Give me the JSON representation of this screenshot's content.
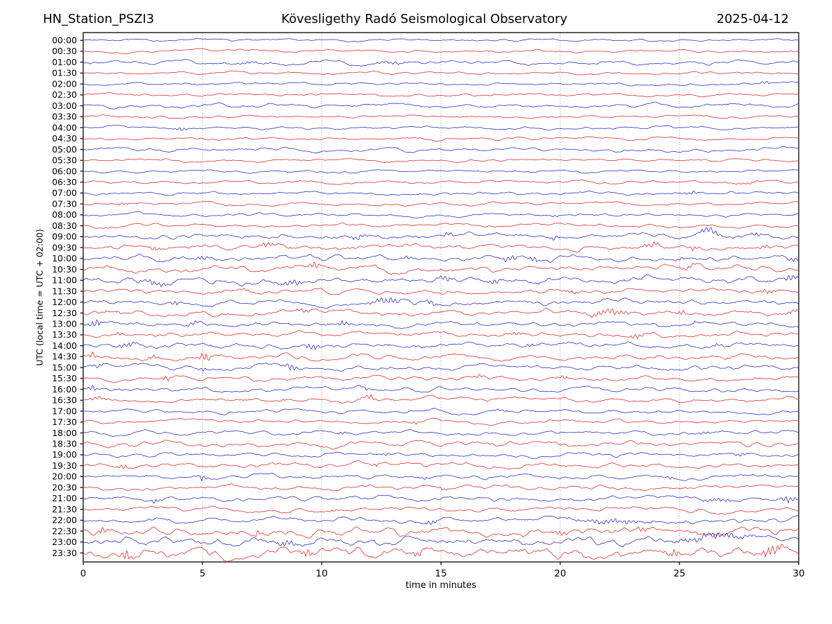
{
  "header": {
    "station": "HN_Station_PSZI3",
    "observatory": "Kövesligethy Radó Seismological Observatory",
    "date": "2025-04-12"
  },
  "chart_data": {
    "type": "line",
    "variant": "helicorder-seismogram",
    "title": "HN_Station_PSZI3 — Kövesligethy Radó Seismological Observatory — 2025-04-12",
    "xlabel": "time in minutes",
    "ylabel": "UTC (local time = UTC + 02:00)",
    "x_range": [
      0,
      30
    ],
    "xticks": [
      0,
      5,
      10,
      15,
      20,
      25,
      30
    ],
    "grid_minutes": [
      5,
      10,
      15,
      20,
      25
    ],
    "grid_on": true,
    "legend": "none",
    "row_interval_minutes": 30,
    "colors": {
      "blue_trace": "#2323cc",
      "red_trace": "#e02020",
      "grid": "#777777",
      "axis": "#000000",
      "text": "#000000"
    },
    "traces": [
      {
        "label": "00:00",
        "color": "blue",
        "amp": 0.45,
        "events": []
      },
      {
        "label": "00:30",
        "color": "red",
        "amp": 0.45,
        "events": []
      },
      {
        "label": "01:00",
        "color": "blue",
        "amp": 0.75,
        "events": [
          [
            7.0,
            2.0,
            0.6
          ],
          [
            13.0,
            2.0,
            0.6
          ]
        ]
      },
      {
        "label": "01:30",
        "color": "red",
        "amp": 0.5,
        "events": []
      },
      {
        "label": "02:00",
        "color": "blue",
        "amp": 0.5,
        "events": [
          [
            28.6,
            0.4,
            1.0
          ]
        ]
      },
      {
        "label": "02:30",
        "color": "red",
        "amp": 0.55,
        "events": []
      },
      {
        "label": "03:00",
        "color": "blue",
        "amp": 0.7,
        "events": []
      },
      {
        "label": "03:30",
        "color": "red",
        "amp": 0.5,
        "events": []
      },
      {
        "label": "04:00",
        "color": "blue",
        "amp": 0.5,
        "events": [
          [
            4.1,
            0.6,
            1.2
          ]
        ]
      },
      {
        "label": "04:30",
        "color": "red",
        "amp": 0.5,
        "events": []
      },
      {
        "label": "05:00",
        "color": "blue",
        "amp": 0.7,
        "events": []
      },
      {
        "label": "05:30",
        "color": "red",
        "amp": 0.5,
        "events": [
          [
            12.8,
            0.4,
            0.8
          ]
        ]
      },
      {
        "label": "06:00",
        "color": "blue",
        "amp": 0.5,
        "events": []
      },
      {
        "label": "06:30",
        "color": "red",
        "amp": 0.55,
        "events": [
          [
            27.8,
            1.2,
            0.9
          ]
        ]
      },
      {
        "label": "07:00",
        "color": "blue",
        "amp": 0.6,
        "events": [
          [
            25.5,
            0.8,
            0.9
          ]
        ]
      },
      {
        "label": "07:30",
        "color": "red",
        "amp": 0.55,
        "events": [
          [
            1.6,
            0.4,
            0.9
          ]
        ]
      },
      {
        "label": "08:00",
        "color": "blue",
        "amp": 0.55,
        "events": [
          [
            19.8,
            0.3,
            1.3
          ]
        ]
      },
      {
        "label": "08:30",
        "color": "red",
        "amp": 0.6,
        "events": []
      },
      {
        "label": "09:00",
        "color": "blue",
        "amp": 1.1,
        "events": [
          [
            11.5,
            0.5,
            1.8
          ],
          [
            15.3,
            0.5,
            1.8
          ],
          [
            19.8,
            0.4,
            1.8
          ],
          [
            26.3,
            0.8,
            2.2
          ],
          [
            28.2,
            0.4,
            1.6
          ]
        ]
      },
      {
        "label": "09:30",
        "color": "red",
        "amp": 1.0,
        "events": [
          [
            3.0,
            0.5,
            1.4
          ],
          [
            7.7,
            0.5,
            1.9
          ],
          [
            23.8,
            0.6,
            1.9
          ],
          [
            25.6,
            0.4,
            1.4
          ],
          [
            28.5,
            0.5,
            1.4
          ]
        ]
      },
      {
        "label": "10:00",
        "color": "blue",
        "amp": 1.0,
        "events": [
          [
            5.0,
            0.5,
            1.5
          ],
          [
            13.6,
            0.4,
            1.4
          ],
          [
            17.9,
            0.5,
            2.2
          ],
          [
            18.9,
            0.4,
            1.8
          ],
          [
            25.1,
            0.4,
            1.4
          ],
          [
            29.8,
            0.4,
            1.8
          ]
        ]
      },
      {
        "label": "10:30",
        "color": "red",
        "amp": 1.1,
        "events": [
          [
            9.7,
            0.5,
            2.2
          ],
          [
            25.4,
            0.5,
            1.4
          ]
        ]
      },
      {
        "label": "11:00",
        "color": "blue",
        "amp": 1.2,
        "events": [
          [
            3.0,
            1.5,
            1.7
          ],
          [
            8.8,
            1.0,
            2.2
          ],
          [
            15.2,
            0.5,
            2.6
          ],
          [
            17.2,
            0.5,
            1.5
          ],
          [
            29.7,
            0.5,
            2.6
          ]
        ]
      },
      {
        "label": "11:30",
        "color": "red",
        "amp": 0.9,
        "events": [
          [
            6.8,
            0.4,
            1.4
          ],
          [
            20.6,
            0.5,
            1.4
          ],
          [
            28.7,
            0.5,
            1.8
          ]
        ]
      },
      {
        "label": "12:00",
        "color": "blue",
        "amp": 1.0,
        "events": [
          [
            3.8,
            0.4,
            1.3
          ],
          [
            12.7,
            1.2,
            2.2
          ],
          [
            14.6,
            0.5,
            1.8
          ]
        ]
      },
      {
        "label": "12:30",
        "color": "red",
        "amp": 1.0,
        "events": [
          [
            9.2,
            0.5,
            1.4
          ],
          [
            22.0,
            1.5,
            1.8
          ],
          [
            25.1,
            0.4,
            1.4
          ],
          [
            29.7,
            0.4,
            1.4
          ]
        ]
      },
      {
        "label": "13:00",
        "color": "blue",
        "amp": 1.0,
        "events": [
          [
            0.5,
            0.5,
            2.2
          ],
          [
            4.6,
            0.5,
            1.3
          ],
          [
            10.9,
            0.5,
            1.8
          ]
        ]
      },
      {
        "label": "13:30",
        "color": "red",
        "amp": 0.9,
        "events": [
          [
            1.5,
            0.4,
            1.0
          ],
          [
            18.2,
            0.5,
            1.0
          ],
          [
            23.2,
            0.5,
            2.2
          ]
        ]
      },
      {
        "label": "14:00",
        "color": "blue",
        "amp": 1.0,
        "events": [
          [
            1.8,
            0.8,
            1.8
          ],
          [
            9.6,
            0.5,
            2.2
          ],
          [
            18.8,
            0.5,
            1.4
          ],
          [
            26.6,
            0.5,
            1.3
          ]
        ]
      },
      {
        "label": "14:30",
        "color": "red",
        "amp": 1.0,
        "events": [
          [
            0.4,
            0.4,
            1.8
          ],
          [
            2.9,
            0.5,
            1.4
          ],
          [
            5.1,
            0.45,
            3.0
          ],
          [
            27.0,
            0.5,
            1.0
          ]
        ]
      },
      {
        "label": "15:00",
        "color": "blue",
        "amp": 0.9,
        "events": [
          [
            0.6,
            0.4,
            1.4
          ],
          [
            5.0,
            0.4,
            1.3
          ],
          [
            8.7,
            0.5,
            2.6
          ]
        ]
      },
      {
        "label": "15:30",
        "color": "red",
        "amp": 0.85,
        "events": [
          [
            3.5,
            0.3,
            2.4
          ],
          [
            16.6,
            0.4,
            1.0
          ],
          [
            20.1,
            0.5,
            1.3
          ],
          [
            28.2,
            0.4,
            1.0
          ]
        ]
      },
      {
        "label": "16:00",
        "color": "blue",
        "amp": 0.8,
        "events": [
          [
            0.4,
            0.4,
            2.0
          ],
          [
            11.9,
            0.4,
            1.0
          ]
        ]
      },
      {
        "label": "16:30",
        "color": "red",
        "amp": 0.8,
        "events": [
          [
            0.6,
            0.8,
            1.0
          ],
          [
            12.0,
            0.5,
            2.4
          ]
        ]
      },
      {
        "label": "17:00",
        "color": "blue",
        "amp": 0.7,
        "events": [
          [
            17.5,
            0.5,
            1.0
          ]
        ]
      },
      {
        "label": "17:30",
        "color": "red",
        "amp": 0.65,
        "events": [
          [
            13.9,
            0.4,
            0.9
          ]
        ]
      },
      {
        "label": "18:00",
        "color": "blue",
        "amp": 0.75,
        "events": [
          [
            10.9,
            0.4,
            1.0
          ],
          [
            26.0,
            0.5,
            0.9
          ]
        ]
      },
      {
        "label": "18:30",
        "color": "red",
        "amp": 0.95,
        "events": []
      },
      {
        "label": "19:00",
        "color": "blue",
        "amp": 0.8,
        "events": [
          [
            12.6,
            0.4,
            1.0
          ],
          [
            27.6,
            0.5,
            1.2
          ]
        ]
      },
      {
        "label": "19:30",
        "color": "red",
        "amp": 0.85,
        "events": [
          [
            1.7,
            0.4,
            1.9
          ],
          [
            12.3,
            0.4,
            1.0
          ]
        ]
      },
      {
        "label": "20:00",
        "color": "blue",
        "amp": 0.8,
        "events": [
          [
            5.0,
            0.4,
            1.5
          ],
          [
            14.3,
            0.4,
            1.2
          ],
          [
            24.6,
            0.4,
            1.0
          ]
        ]
      },
      {
        "label": "20:30",
        "color": "red",
        "amp": 0.85,
        "events": [
          [
            15.0,
            0.5,
            1.1
          ]
        ]
      },
      {
        "label": "21:00",
        "color": "blue",
        "amp": 0.85,
        "events": [
          [
            3.0,
            0.4,
            1.4
          ],
          [
            26.6,
            1.0,
            1.4
          ],
          [
            29.6,
            0.6,
            2.2
          ]
        ]
      },
      {
        "label": "21:30",
        "color": "red",
        "amp": 0.8,
        "events": [
          [
            10.5,
            0.4,
            1.0
          ]
        ]
      },
      {
        "label": "22:00",
        "color": "blue",
        "amp": 1.0,
        "events": [
          [
            14.6,
            0.5,
            1.4
          ],
          [
            22.0,
            3.0,
            1.3
          ]
        ]
      },
      {
        "label": "22:30",
        "color": "red",
        "amp": 1.5,
        "events": [
          [
            0.8,
            0.4,
            2.2
          ],
          [
            7.3,
            0.3,
            2.6
          ],
          [
            20.0,
            0.5,
            1.8
          ],
          [
            23.5,
            0.5,
            1.8
          ],
          [
            26.5,
            0.5,
            1.8
          ]
        ]
      },
      {
        "label": "23:00",
        "color": "blue",
        "amp": 1.5,
        "events": [
          [
            8.5,
            0.8,
            1.8
          ],
          [
            26.5,
            3.0,
            1.9
          ]
        ]
      },
      {
        "label": "23:30",
        "color": "red",
        "amp": 2.0,
        "events": [
          [
            1.8,
            0.4,
            2.6
          ],
          [
            9.4,
            0.4,
            3.2
          ],
          [
            14.0,
            0.5,
            2.2
          ],
          [
            24.8,
            0.4,
            3.0
          ],
          [
            28.9,
            0.8,
            3.6
          ]
        ]
      }
    ]
  }
}
